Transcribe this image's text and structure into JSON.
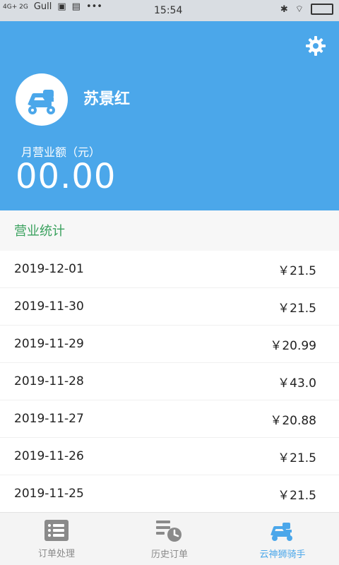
{
  "status": {
    "network_left": "4G+ 2G",
    "signal_label": "Gull",
    "time": "15:54",
    "dots": "•••"
  },
  "header": {
    "user_name": "苏景红",
    "monthly_revenue_label": "月营业额（元）",
    "monthly_revenue_value": "00.00"
  },
  "stats": {
    "title": "营业统计",
    "rows": [
      {
        "date": "2019-12-01",
        "amount": "￥21.5"
      },
      {
        "date": "2019-11-30",
        "amount": "￥21.5"
      },
      {
        "date": "2019-11-29",
        "amount": "￥20.99"
      },
      {
        "date": "2019-11-28",
        "amount": "￥43.0"
      },
      {
        "date": "2019-11-27",
        "amount": "￥20.88"
      },
      {
        "date": "2019-11-26",
        "amount": "￥21.5"
      },
      {
        "date": "2019-11-25",
        "amount": "￥21.5"
      }
    ]
  },
  "tabs": [
    {
      "label": "订单处理",
      "icon": "list-icon"
    },
    {
      "label": "历史订单",
      "icon": "history-icon"
    },
    {
      "label": "云神狮骑手",
      "icon": "scooter-icon",
      "active": true
    }
  ],
  "colors": {
    "header_bg": "#4ba7ea",
    "section_title": "#3aa15e",
    "active_tab": "#4ba7ea"
  }
}
